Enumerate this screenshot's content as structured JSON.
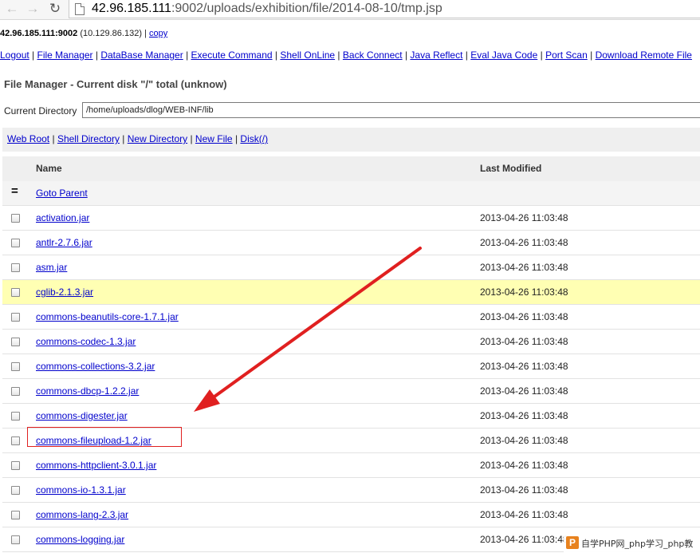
{
  "browser": {
    "url_host": "42.96.185.111",
    "url_rest": ":9002/uploads/exhibition/file/2014-08-10/tmp.jsp",
    "back_icon": "arrow-left-icon",
    "forward_icon": "arrow-right-icon",
    "reload_icon": "reload-icon"
  },
  "server_line": {
    "host": "42.96.185.111:9002",
    "local_ip": " (10.129.86.132) | ",
    "copy_label": "copy"
  },
  "menu": [
    "Logout",
    "File Manager",
    "DataBase Manager",
    "Execute Command",
    "Shell OnLine",
    "Back Connect",
    "Java Reflect",
    "Eval Java Code",
    "Port Scan",
    "Download Remote File"
  ],
  "panel": {
    "title": "File Manager - Current disk \"/\" total (unknow)",
    "current_dir_label": "Current Directory",
    "current_dir_value": "/home/uploads/dlog/WEB-INF/lib"
  },
  "tools": [
    "Web Root",
    "Shell Directory",
    "New Directory",
    "New File",
    "Disk(/)"
  ],
  "table": {
    "col_name": "Name",
    "col_modified": "Last Modified",
    "goto_parent": "Goto Parent",
    "goto_symbol": "="
  },
  "files": [
    {
      "name": "activation.jar",
      "modified": "2013-04-26 11:03:48"
    },
    {
      "name": "antlr-2.7.6.jar",
      "modified": "2013-04-26 11:03:48"
    },
    {
      "name": "asm.jar",
      "modified": "2013-04-26 11:03:48"
    },
    {
      "name": "cglib-2.1.3.jar",
      "modified": "2013-04-26 11:03:48"
    },
    {
      "name": "commons-beanutils-core-1.7.1.jar",
      "modified": "2013-04-26 11:03:48"
    },
    {
      "name": "commons-codec-1.3.jar",
      "modified": "2013-04-26 11:03:48"
    },
    {
      "name": "commons-collections-3.2.jar",
      "modified": "2013-04-26 11:03:48"
    },
    {
      "name": "commons-dbcp-1.2.2.jar",
      "modified": "2013-04-26 11:03:48"
    },
    {
      "name": "commons-digester.jar",
      "modified": "2013-04-26 11:03:48"
    },
    {
      "name": "commons-fileupload-1.2.jar",
      "modified": "2013-04-26 11:03:48"
    },
    {
      "name": "commons-httpclient-3.0.1.jar",
      "modified": "2013-04-26 11:03:48"
    },
    {
      "name": "commons-io-1.3.1.jar",
      "modified": "2013-04-26 11:03:48"
    },
    {
      "name": "commons-lang-2.3.jar",
      "modified": "2013-04-26 11:03:48"
    },
    {
      "name": "commons-logging.jar",
      "modified": "2013-04-26 11:03:48"
    }
  ],
  "highlighted_row_color": "#ffffb3",
  "annotation_color": "#e02020",
  "watermark": {
    "logo": "P",
    "text": "自学PHP网_php学习_php教"
  }
}
